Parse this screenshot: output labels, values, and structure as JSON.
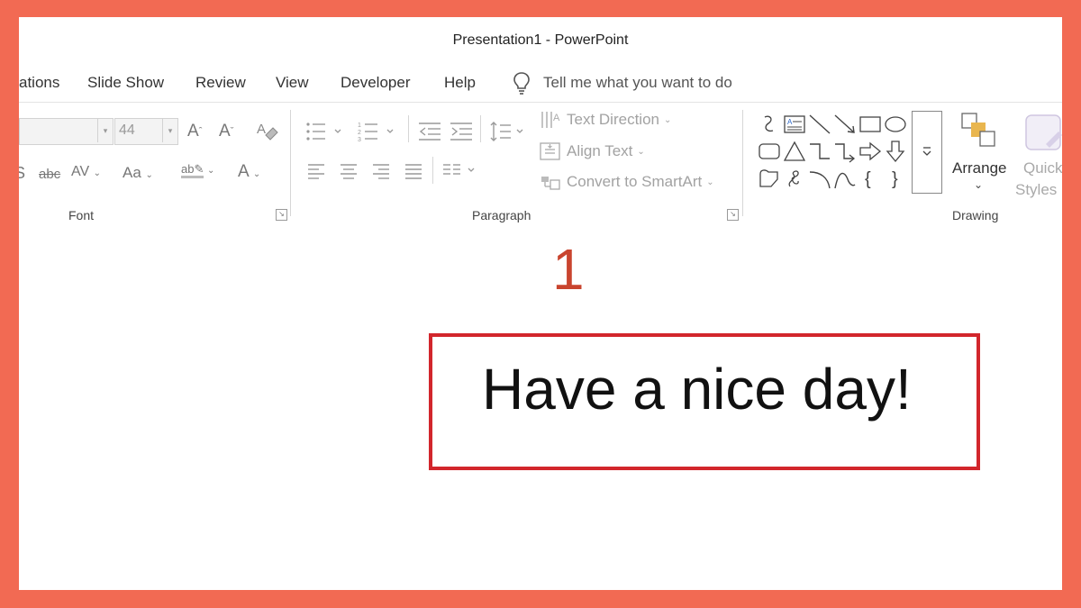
{
  "window": {
    "title": "Presentation1  -  PowerPoint"
  },
  "tabs": [
    {
      "label": "ations"
    },
    {
      "label": "Slide Show"
    },
    {
      "label": "Review"
    },
    {
      "label": "View"
    },
    {
      "label": "Developer"
    },
    {
      "label": "Help"
    }
  ],
  "tell_me": {
    "placeholder": "Tell me what you want to do"
  },
  "ribbon": {
    "font_group": {
      "label": "Font",
      "font_size": "44"
    },
    "paragraph_group": {
      "label": "Paragraph",
      "text_direction": "Text Direction",
      "align_text": "Align Text",
      "convert_smartart": "Convert to SmartArt"
    },
    "drawing_group": {
      "label": "Drawing",
      "arrange": "Arrange",
      "quick_styles_line1": "Quick",
      "quick_styles_line2": "Styles"
    }
  },
  "slide": {
    "step_number": "1",
    "textbox_text": "Have a nice day!"
  },
  "colors": {
    "frame": "#F26A53",
    "highlight_border": "#D2262C",
    "step_number": "#C9442E"
  }
}
